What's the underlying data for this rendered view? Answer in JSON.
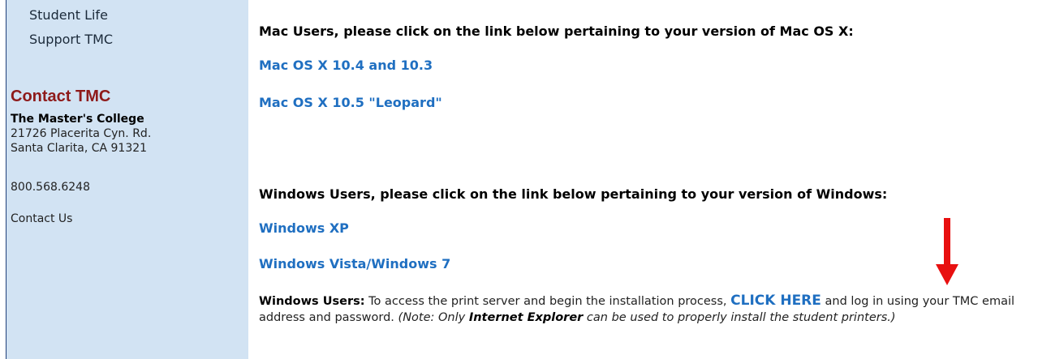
{
  "sidebar": {
    "nav_items": [
      {
        "label": "Student Life"
      },
      {
        "label": "Support TMC"
      }
    ],
    "contact": {
      "title": "Contact TMC",
      "organization": "The Master's College",
      "address_line1": "21726 Placerita Cyn. Rd.",
      "address_line2": "Santa Clarita, CA 91321",
      "phone": "800.568.6248",
      "contact_us_label": "Contact Us"
    }
  },
  "main": {
    "mac_heading": "Mac Users, please click on the link below pertaining to your version of Mac OS X:",
    "mac_links": [
      "Mac OS X 10.4 and 10.3",
      "Mac OS X 10.5 \"Leopard\""
    ],
    "windows_heading": "Windows Users, please click on the link below pertaining to your version of Windows:",
    "windows_links": [
      "Windows XP",
      "Windows Vista/Windows 7"
    ],
    "install": {
      "lead": "Windows Users:",
      "text_before": " To access the print server and begin the installation process, ",
      "cta_label": "CLICK HERE",
      "text_after": " and log in using your TMC email address and password. ",
      "note_before": "(Note: Only ",
      "note_emphasis": "Internet Explorer",
      "note_after": " can be used to properly install the student printers.)"
    },
    "arrow_icon": "red-down-arrow-icon"
  },
  "colors": {
    "sidebar_bg": "#d2e3f3",
    "link": "#1f6fc1",
    "contact_title": "#8e1a1a",
    "arrow": "#e81010"
  }
}
